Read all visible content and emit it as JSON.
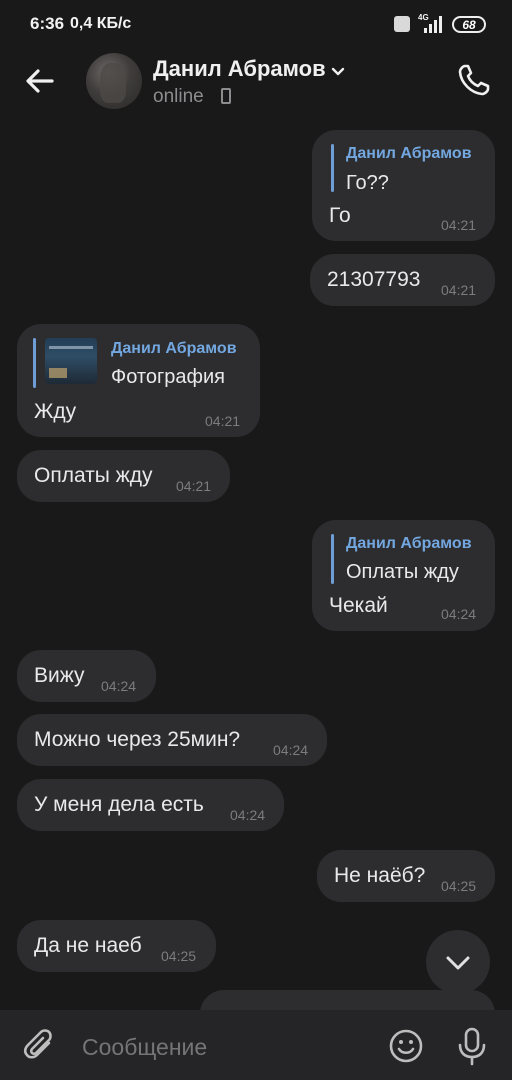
{
  "status_bar": {
    "time": "6:36",
    "speed": "0,4 КБ/с",
    "network": "4G",
    "battery": "68"
  },
  "header": {
    "name": "Данил Абрамов",
    "status": "online"
  },
  "messages": [
    {
      "side": "out",
      "reply_author": "Данил Абрамов",
      "reply_text": "Го??",
      "text": "Го",
      "time": "04:21"
    },
    {
      "side": "out",
      "text": "21307793",
      "time": "04:21"
    },
    {
      "side": "in",
      "reply_author": "Данил Абрамов",
      "reply_text": "Фотография",
      "text": "Жду",
      "time": "04:21"
    },
    {
      "side": "in",
      "text": "Оплаты жду",
      "time": "04:21"
    },
    {
      "side": "out",
      "reply_author": "Данил Абрамов",
      "reply_text": "Оплаты жду",
      "text": "Чекай",
      "time": "04:24"
    },
    {
      "side": "in",
      "text": "Вижу",
      "time": "04:24"
    },
    {
      "side": "in",
      "text": "Можно через 25мин?",
      "time": "04:24"
    },
    {
      "side": "in",
      "text": "У меня дела есть",
      "time": "04:24"
    },
    {
      "side": "out",
      "text": "Не наёб?",
      "time": "04:25"
    },
    {
      "side": "in",
      "text": "Да не наеб",
      "time": "04:25"
    }
  ],
  "input": {
    "placeholder": "Сообщение"
  },
  "icons": {
    "back": "arrow-left-icon",
    "call": "phone-icon",
    "chevron": "chevron-down-icon",
    "attach": "paperclip-icon",
    "emoji": "smile-icon",
    "mic": "microphone-icon",
    "scroll": "chevron-down-icon"
  },
  "colors": {
    "background": "#19191a",
    "bubble": "#2d2d2f",
    "accent": "#73a7e0",
    "time": "#7c7c7f"
  }
}
